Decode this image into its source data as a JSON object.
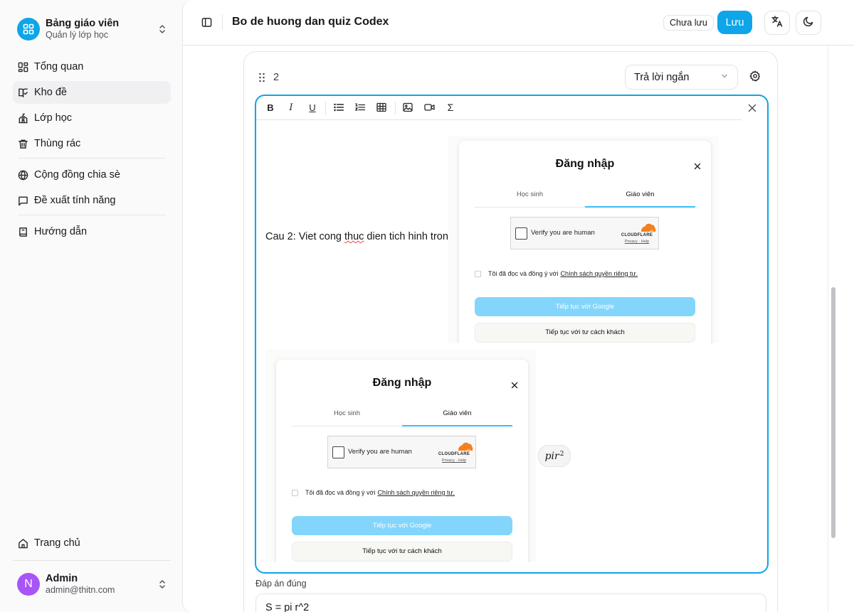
{
  "sidebar": {
    "brand_title": "Bảng giáo viên",
    "brand_subtitle": "Quản lý lớp học",
    "items": [
      {
        "label": "Tổng quan"
      },
      {
        "label": "Kho đề"
      },
      {
        "label": "Lớp học"
      },
      {
        "label": "Thùng rác"
      },
      {
        "label": "Cộng đồng chia sè"
      },
      {
        "label": "Đề xuất tính năng"
      },
      {
        "label": "Hướng dẫn"
      }
    ],
    "active_item": "Kho đề",
    "home_label": "Trang chủ",
    "user": {
      "initial": "N",
      "name": "Admin",
      "email": "admin@thitn.com"
    }
  },
  "header": {
    "title": "Bo de huong dan quiz Codex",
    "unsaved_badge": "Chưa lưu",
    "save_label": "Lưu"
  },
  "question": {
    "number": "2",
    "type": "Trả lời ngắn",
    "text_before": "Cau 2: Viet cong ",
    "text_misspelled": "thuc",
    "text_after": " dien tich hinh tron.",
    "math_base": "pir",
    "math_exp": "2",
    "answer_label": "Đáp án đúng",
    "answer_value": "S = pi r^2"
  },
  "embedded_login": {
    "title": "Đăng nhập",
    "tab_student": "Học sinh",
    "tab_teacher": "Giáo viên",
    "captcha_text": "Verify you are human",
    "captcha_brand": "CLOUDFLARE",
    "captcha_links": "Privacy · Help",
    "consent_text": "Tôi đã đọc và đồng ý với",
    "consent_link": "Chính sách quyền riêng tư.",
    "google_button": "Tiếp tục với Google",
    "guest_button": "Tiếp tục với tư cách khách"
  },
  "colors": {
    "accent": "#0ea5e9",
    "avatar": "#a855f7",
    "google_button": "#7dd3fc",
    "cloudflare": "#f38020"
  }
}
